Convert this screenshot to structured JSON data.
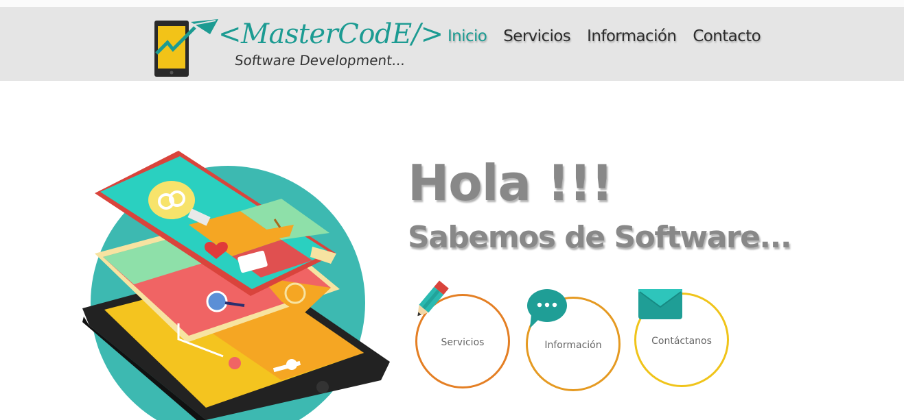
{
  "brand": {
    "name": "<MasterCodE/>",
    "tagline": "Software Development..."
  },
  "nav": {
    "items": [
      {
        "label": "Inicio",
        "active": true
      },
      {
        "label": "Servicios"
      },
      {
        "label": "Información"
      },
      {
        "label": "Contacto"
      }
    ]
  },
  "hero": {
    "title": "Hola !!!",
    "subtitle": "Sabemos de Software..."
  },
  "features": [
    {
      "label": "Servicios",
      "icon": "pencil-icon",
      "ring_color": "#e47f24"
    },
    {
      "label": "Información",
      "icon": "chat-bubble-icon",
      "ring_color": "#e59a22"
    },
    {
      "label": "Contáctanos",
      "icon": "envelope-icon",
      "ring_color": "#f0c41a"
    }
  ],
  "colors": {
    "accent": "#1c9b92",
    "header_bg": "#e5e5e5",
    "heading_gray": "#888888"
  }
}
